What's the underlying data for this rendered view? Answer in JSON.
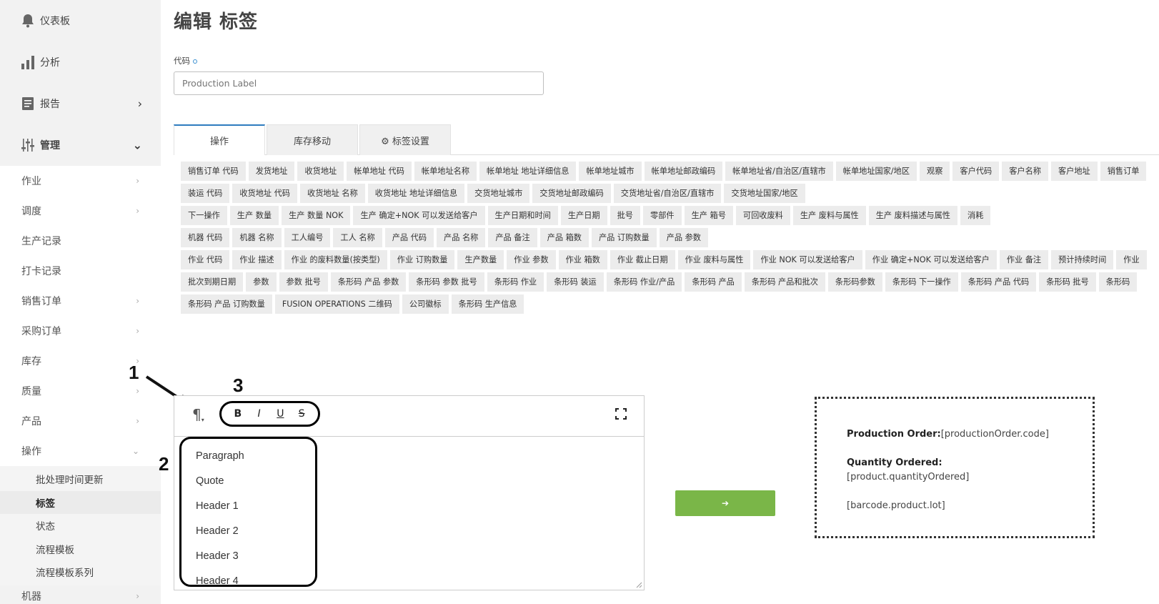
{
  "sidebar": {
    "top_items": [
      {
        "label": "仪表板",
        "icon": "bell-icon"
      },
      {
        "label": "分析",
        "icon": "bar-chart-icon"
      },
      {
        "label": "报告",
        "icon": "report-icon",
        "chevron": "›"
      },
      {
        "label": "管理",
        "icon": "sliders-icon",
        "chevron": "⌄"
      }
    ],
    "items": [
      {
        "label": "作业",
        "chevron": "›"
      },
      {
        "label": "调度",
        "chevron": "›"
      },
      {
        "label": "生产记录",
        "chevron": ""
      },
      {
        "label": "打卡记录",
        "chevron": ""
      },
      {
        "label": "销售订单",
        "chevron": "›"
      },
      {
        "label": "采购订单",
        "chevron": "›"
      },
      {
        "label": "库存",
        "chevron": "›"
      },
      {
        "label": "质量",
        "chevron": "›"
      },
      {
        "label": "产品",
        "chevron": "›"
      },
      {
        "label": "操作",
        "chevron": "⌄"
      }
    ],
    "subitems": [
      "批处理时间更新",
      "标签",
      "状态",
      "流程模板",
      "流程模板系列"
    ],
    "active_subitem": "标签",
    "bottom_item": {
      "label": "机器",
      "chevron": "›"
    }
  },
  "page": {
    "title": "编辑 标签",
    "code_label": "代码",
    "code_placeholder": "Production Label"
  },
  "tabs": [
    {
      "label": "操作",
      "active": true
    },
    {
      "label": "库存移动",
      "active": false
    },
    {
      "label": "⚙ 标签设置",
      "active": false
    }
  ],
  "chip_rows": [
    [
      "销售订单 代码",
      "发货地址",
      "收货地址",
      "帐单地址 代码",
      "帐单地址名称",
      "帐单地址 地址详细信息",
      "帐单地址城市",
      "帐单地址邮政编码",
      "帐单地址省/自治区/直辖市",
      "帐单地址国家/地区",
      "观察",
      "客户代码",
      "客户名称",
      "客户地址",
      "销售订单"
    ],
    [
      "装运 代码",
      "收货地址 代码",
      "收货地址 名称",
      "收货地址 地址详细信息",
      "交货地址城市",
      "交货地址邮政编码",
      "交货地址省/自治区/直辖市",
      "交货地址国家/地区"
    ],
    [
      "下一操作",
      "生产 数量",
      "生产 数量 NOK",
      "生产 确定+NOK 可以发送给客户",
      "生产日期和时间",
      "生产日期",
      "批号",
      "零部件",
      "生产 箱号",
      "可回收废料",
      "生产 废料与属性",
      "生产 废料描述与属性",
      "消耗"
    ],
    [
      "机器 代码",
      "机器 名称",
      "工人编号",
      "工人 名称",
      "产品 代码",
      "产品 名称",
      "产品 备注",
      "产品 箱数",
      "产品 订购数量",
      "产品 参数"
    ],
    [
      "作业 代码",
      "作业 描述",
      "作业 的废料数量(按类型)",
      "作业 订购数量",
      "生产数量",
      "作业 参数",
      "作业 箱数",
      "作业 截止日期",
      "作业 废料与属性",
      "作业 NOK 可以发送给客户",
      "作业 确定+NOK 可以发送给客户",
      "作业 备注",
      "预计持续时间",
      "作业"
    ],
    [
      "批次到期日期",
      "参数",
      "参数 批号",
      "条形码 产品 参数",
      "条形码 参数 批号",
      "条形码 作业",
      "条形码 装运",
      "条形码 作业/产品",
      "条形码 产品",
      "条形码 产品和批次",
      "条形码参数",
      "条形码 下一操作",
      "条形码 产品 代码",
      "条形码 批号",
      "条形码"
    ],
    [
      "条形码 产品 订购数量",
      "FUSION OPERATIONS 二维码",
      "公司徽标",
      "条形码 生产信息"
    ]
  ],
  "editor": {
    "paragraph_symbol": "¶",
    "format_buttons": [
      "B",
      "I",
      "U",
      "S"
    ],
    "block_formats": [
      "Paragraph",
      "Quote",
      "Header 1",
      "Header 2",
      "Header 3",
      "Header 4"
    ]
  },
  "callouts": [
    "1",
    "2",
    "3"
  ],
  "convert_button": {
    "label": "➔"
  },
  "preview": {
    "order_label": "Production Order:",
    "order_value": "[productionOrder.code]",
    "qty_label": "Quantity Ordered:",
    "qty_value": "[product.quantityOrdered]",
    "barcode_value": "[barcode.product.lot]"
  },
  "colors": {
    "accent_tab": "#2e7cbf",
    "convert_button": "#7ab648",
    "sidebar_bg": "#f2f2f2",
    "chip_bg": "#ececec"
  }
}
